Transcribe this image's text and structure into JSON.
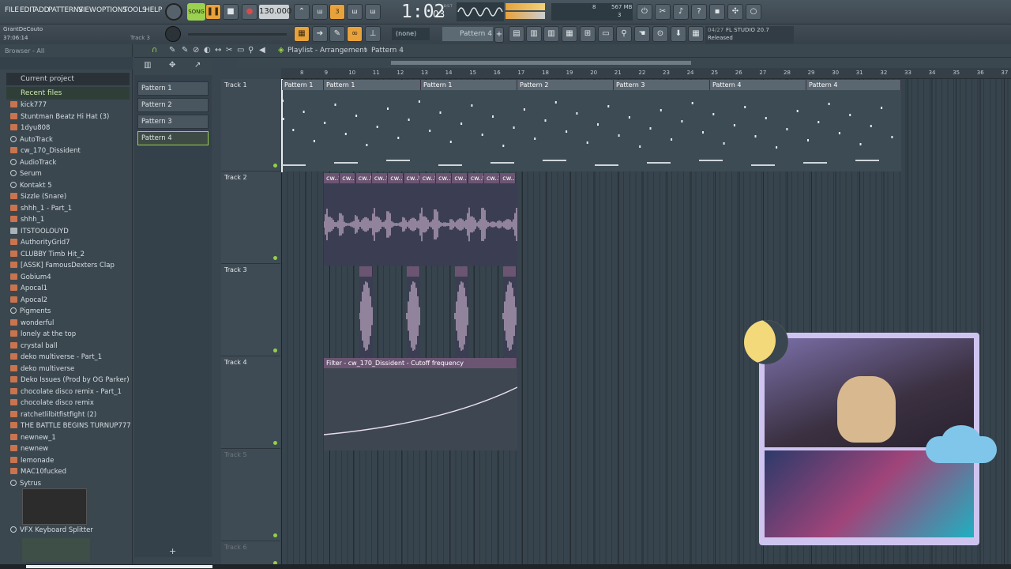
{
  "menu": [
    "FILE",
    "EDIT",
    "ADD",
    "PATTERNS",
    "VIEW",
    "OPTIONS",
    "TOOLS",
    "HELP"
  ],
  "transport": {
    "song_mode": "SONG",
    "tempo": "130.000",
    "time": "1:02",
    "time_sub": "03",
    "time_unit": "B:S:T",
    "mem": "567 MB",
    "cpu_value": "8",
    "voices": "3"
  },
  "hint": {
    "user": "GrantDeCouto",
    "time": "37:06:14",
    "track": "Track 3"
  },
  "pattern_selector": {
    "none": "(none)",
    "current": "Pattern 4"
  },
  "news": {
    "date": "04/27",
    "title": "FL STUDIO 20.7",
    "sub": "Released"
  },
  "browser": {
    "header": "Browser - All",
    "current_project": "Current project",
    "recent_files": "Recent files",
    "items": [
      {
        "label": "kick777",
        "icon": "audio"
      },
      {
        "label": "Stuntman Beatz Hi Hat (3)",
        "icon": "audio"
      },
      {
        "label": "1dyu808",
        "icon": "audio"
      },
      {
        "label": "AutoTrack",
        "icon": "plugin"
      },
      {
        "label": "cw_170_Dissident",
        "icon": "audio"
      },
      {
        "label": "AudioTrack",
        "icon": "plugin"
      },
      {
        "label": "Serum",
        "icon": "plugin"
      },
      {
        "label": "Kontakt 5",
        "icon": "plugin"
      },
      {
        "label": "Sizzle (Snare)",
        "icon": "audio"
      },
      {
        "label": "shhh_1 - Part_1",
        "icon": "audio"
      },
      {
        "label": "shhh_1",
        "icon": "audio"
      },
      {
        "label": "ITSTOOLOUYD",
        "icon": "doc"
      },
      {
        "label": "AuthorityGrid7",
        "icon": "audio"
      },
      {
        "label": "CLUBBY Timb Hit_2",
        "icon": "audio"
      },
      {
        "label": "[ASSK] FamousDexters Clap",
        "icon": "audio"
      },
      {
        "label": "Gobium4",
        "icon": "audio"
      },
      {
        "label": "Apocal1",
        "icon": "audio"
      },
      {
        "label": "Apocal2",
        "icon": "audio"
      },
      {
        "label": "Pigments",
        "icon": "plugin"
      },
      {
        "label": "wonderful",
        "icon": "audio"
      },
      {
        "label": "lonely at the top",
        "icon": "audio"
      },
      {
        "label": "crystal ball",
        "icon": "audio"
      },
      {
        "label": "deko multiverse - Part_1",
        "icon": "audio"
      },
      {
        "label": "deko multiverse",
        "icon": "audio"
      },
      {
        "label": "Deko Issues (Prod by OG Parker)",
        "icon": "audio"
      },
      {
        "label": "chocolate disco remix - Part_1",
        "icon": "audio"
      },
      {
        "label": "chocolate disco remix",
        "icon": "audio"
      },
      {
        "label": "ratchetlilbitfistfight (2)",
        "icon": "audio"
      },
      {
        "label": "THE BATTLE BEGINS TURNUP777",
        "icon": "audio"
      },
      {
        "label": "newnew_1",
        "icon": "audio"
      },
      {
        "label": "newnew",
        "icon": "audio"
      },
      {
        "label": "lemonade",
        "icon": "audio"
      },
      {
        "label": "MAC10fucked",
        "icon": "audio"
      },
      {
        "label": "Sytrus",
        "icon": "plugin"
      }
    ],
    "last": "VFX Keyboard Splitter"
  },
  "patterns": [
    "Pattern 1",
    "Pattern 2",
    "Pattern 3",
    "Pattern 4"
  ],
  "playlist": {
    "title": "Playlist - Arrangement",
    "pattern": "Pattern 4",
    "tracks": [
      "Track 1",
      "Track 2",
      "Track 3",
      "Track 4",
      "Track 5",
      "Track 6"
    ],
    "bars": [
      "8",
      "9",
      "10",
      "11",
      "12",
      "13",
      "14",
      "15",
      "16",
      "17",
      "18",
      "19",
      "20",
      "21",
      "22",
      "23",
      "24",
      "25",
      "26",
      "27",
      "28",
      "29",
      "30",
      "31",
      "32",
      "33",
      "34",
      "35",
      "36",
      "37"
    ],
    "pattern_clips": [
      "Pattern 1",
      "Pattern 1",
      "Pattern 1",
      "Pattern 2",
      "Pattern 3",
      "Pattern 4",
      "Pattern 4"
    ],
    "audio_clip": "cw..t",
    "automation_clip": "Filter - cw_170_Dissident - Cutoff frequency"
  },
  "colors": {
    "accent": "#e8a23b",
    "led": "#8fd24a",
    "audio": "#e8c8e6",
    "clip": "#6b5573"
  }
}
